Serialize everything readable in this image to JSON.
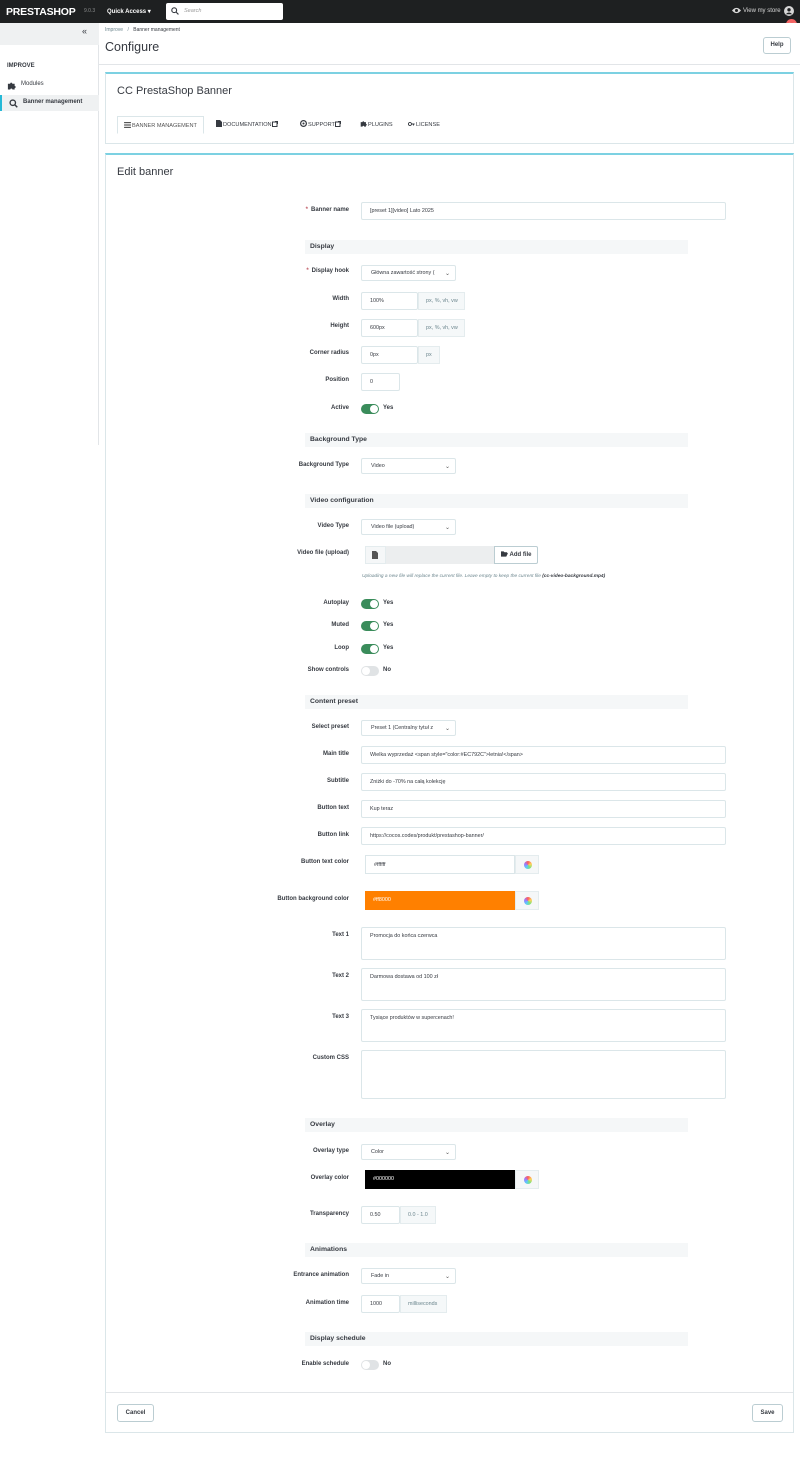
{
  "topbar": {
    "logo": "PRESTASHOP",
    "version": "9.0.3",
    "quick_access": "Quick Access ▾",
    "search_placeholder": "Search",
    "view_store": "View my store"
  },
  "sidebar": {
    "collapse_label": "«",
    "section": "IMPROVE",
    "items": [
      {
        "label": "Modules",
        "icon": "puzzle-icon"
      },
      {
        "label": "Banner management",
        "icon": "cog-search-icon"
      }
    ]
  },
  "header": {
    "breadcrumb": [
      "Improve",
      "Banner management"
    ],
    "breadcrumb_sep": "/",
    "title": "Configure",
    "help": "Help"
  },
  "module": {
    "title": "CC PrestaShop Banner",
    "tabs": [
      "BANNER MANAGEMENT",
      "DOCUMENTATION",
      "SUPPORT",
      "PLUGINS",
      "LICENSE"
    ]
  },
  "form": {
    "title": "Edit banner",
    "banner_name_label": "Banner name",
    "banner_name_value": "[preset 1][video] Lato 2025",
    "sections": {
      "display": "Display",
      "background": "Background Type",
      "video": "Video configuration",
      "content": "Content preset",
      "overlay": "Overlay",
      "animations": "Animations",
      "schedule": "Display schedule"
    },
    "display_hook_label": "Display hook",
    "display_hook_value": "Główna zawartość strony (",
    "width_label": "Width",
    "width_value": "100%",
    "width_unit": "px, %, vh, vw",
    "height_label": "Height",
    "height_value": "600px",
    "height_unit": "px, %, vh, vw",
    "radius_label": "Corner radius",
    "radius_value": "0px",
    "radius_unit": "px",
    "position_label": "Position",
    "position_value": "0",
    "active_label": "Active",
    "yes": "Yes",
    "no": "No",
    "bg_type_label": "Background Type",
    "bg_type_value": "Video",
    "video_type_label": "Video Type",
    "video_type_value": "Video file (upload)",
    "video_file_label": "Video file (upload)",
    "add_file": "Add file",
    "upload_note": "Uploading a new file will replace the current file. Leave empty to keep the current file",
    "upload_note_file": "(cc-video-background.mp4)",
    "autoplay_label": "Autoplay",
    "muted_label": "Muted",
    "loop_label": "Loop",
    "controls_label": "Show controls",
    "preset_label": "Select preset",
    "preset_value": "Preset 1 (Centralny tytuł z",
    "main_title_label": "Main title",
    "main_title_value": "Wielka wyprzedaż <span style=\"color:#EC792C\">letnia!</span>",
    "subtitle_label": "Subtitle",
    "subtitle_value": "Zniżki do -70% na całą kolekcję",
    "button_text_label": "Button text",
    "button_text_value": "Kup teraz",
    "button_link_label": "Button link",
    "button_link_value": "https://cocos.codes/produkt/prestashop-banner/",
    "btn_text_color_label": "Button text color",
    "btn_text_color_value": "#ffffff",
    "btn_bg_color_label": "Button background color",
    "btn_bg_color_value": "#ff8000",
    "text1_label": "Text 1",
    "text1_value": "Promocja do końca czerwca",
    "text2_label": "Text 2",
    "text2_value": "Darmowa dostawa od 100 zł",
    "text3_label": "Text 3",
    "text3_value": "Tysiące produktów w supercenach!",
    "css_label": "Custom CSS",
    "css_value": "",
    "overlay_type_label": "Overlay type",
    "overlay_type_value": "Color",
    "overlay_color_label": "Overlay color",
    "overlay_color_value": "#000000",
    "transparency_label": "Transparency",
    "transparency_value": "0.50",
    "transparency_unit": "0.0 - 1.0",
    "entrance_label": "Entrance animation",
    "entrance_value": "Fade in",
    "anim_time_label": "Animation time",
    "anim_time_value": "1000",
    "anim_time_unit": "milliseconds",
    "schedule_label": "Enable schedule",
    "cancel": "Cancel",
    "save": "Save"
  },
  "colors": {
    "accent": "#25b9d7",
    "switch_on": "#3a8c5b",
    "button_bg": "#ff8000",
    "overlay": "#000000",
    "topbar": "#1e2021"
  }
}
